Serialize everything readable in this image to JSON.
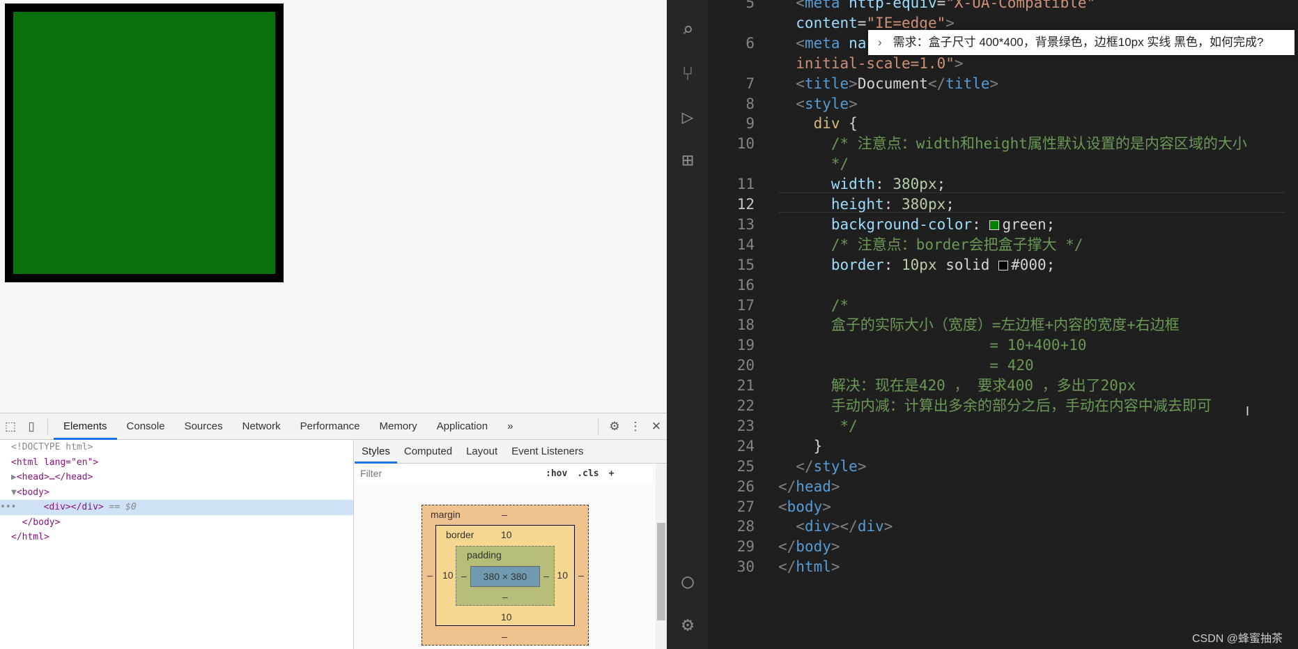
{
  "browser": {
    "box_color": "#0a700a",
    "box_border_color": "#000000"
  },
  "devtools": {
    "tabs": [
      "Elements",
      "Console",
      "Sources",
      "Network",
      "Performance",
      "Memory",
      "Application"
    ],
    "more": "»",
    "dom": [
      {
        "indent": "",
        "text": "<!DOCTYPE html>",
        "kind": "doctype"
      },
      {
        "indent": "",
        "text": "<html lang=\"en\">",
        "kind": "tag"
      },
      {
        "indent": "▶",
        "text": "<head>…</head>",
        "kind": "tag"
      },
      {
        "indent": "▼",
        "text": "<body>",
        "kind": "tag"
      },
      {
        "indent": "    ",
        "text": "<div></div>",
        "suffix": " == $0",
        "kind": "selected"
      },
      {
        "indent": "  ",
        "text": "</body>",
        "kind": "tag"
      },
      {
        "indent": "",
        "text": "</html>",
        "kind": "tag"
      }
    ],
    "styles_tabs": [
      "Styles",
      "Computed",
      "Layout",
      "Event Listeners"
    ],
    "filter_placeholder": "Filter",
    "hov": ":hov",
    "cls": ".cls",
    "plus": "+",
    "box_model": {
      "margin_label": "margin",
      "margin": "–",
      "border_label": "border",
      "border": "10",
      "padding_label": "padding",
      "padding": "–",
      "content": "380 × 380"
    }
  },
  "editor": {
    "current_line": "12",
    "tooltip": "需求：盒子尺寸 400*400，背景绿色，边框10px 实线 黑色，如何完成?",
    "rows": [
      {
        "ln": "5",
        "tokens": [
          [
            "  ",
            "t-txt"
          ],
          [
            "<",
            "t-br"
          ],
          [
            "meta",
            "t-tag"
          ],
          [
            " http-equiv",
            "t-attr"
          ],
          [
            "=",
            "t-txt"
          ],
          [
            "\"X-UA-Compatible\"",
            "t-str"
          ]
        ]
      },
      {
        "ln": "",
        "tokens": [
          [
            "  content",
            "t-attr"
          ],
          [
            "=",
            "t-txt"
          ],
          [
            "\"IE=edge\"",
            "t-str"
          ],
          [
            ">",
            "t-br"
          ]
        ]
      },
      {
        "ln": "6",
        "tokens": [
          [
            "  ",
            "t-txt"
          ],
          [
            "<",
            "t-br"
          ],
          [
            "meta",
            "t-tag"
          ],
          [
            " na",
            "t-attr"
          ]
        ]
      },
      {
        "ln": "",
        "tokens": [
          [
            "  initial-scale=1.0\"",
            "t-str"
          ],
          [
            ">",
            "t-br"
          ]
        ]
      },
      {
        "ln": "7",
        "tokens": [
          [
            "  ",
            "t-txt"
          ],
          [
            "<",
            "t-br"
          ],
          [
            "title",
            "t-tag"
          ],
          [
            ">",
            "t-br"
          ],
          [
            "Document",
            "t-txt"
          ],
          [
            "</",
            "t-br"
          ],
          [
            "title",
            "t-tag"
          ],
          [
            ">",
            "t-br"
          ]
        ]
      },
      {
        "ln": "8",
        "tokens": [
          [
            "  ",
            "t-txt"
          ],
          [
            "<",
            "t-br"
          ],
          [
            "style",
            "t-tag"
          ],
          [
            ">",
            "t-br"
          ]
        ]
      },
      {
        "ln": "9",
        "tokens": [
          [
            "    div",
            "t-sel"
          ],
          [
            " {",
            "t-punc"
          ]
        ]
      },
      {
        "ln": "10",
        "tokens": [
          [
            "      /* 注意点：width和height属性默认设置的是内容区域的大小",
            "t-com"
          ]
        ]
      },
      {
        "ln": "",
        "tokens": [
          [
            "      */",
            "t-com"
          ]
        ]
      },
      {
        "ln": "11",
        "tokens": [
          [
            "      width",
            "t-prop"
          ],
          [
            ": ",
            "t-punc"
          ],
          [
            "380px",
            "t-num"
          ],
          [
            ";",
            "t-punc"
          ]
        ]
      },
      {
        "ln": "12",
        "tokens": [
          [
            "      height",
            "t-prop"
          ],
          [
            ": ",
            "t-punc"
          ],
          [
            "380px",
            "t-num"
          ],
          [
            ";",
            "t-punc"
          ]
        ]
      },
      {
        "ln": "13",
        "tokens": [
          [
            "      background-color",
            "t-prop"
          ],
          [
            ": ",
            "t-punc"
          ],
          [
            "#swatch-green",
            "sw"
          ],
          [
            "green",
            "t-txt"
          ],
          [
            ";",
            "t-punc"
          ]
        ]
      },
      {
        "ln": "14",
        "tokens": [
          [
            "      /* 注意点：border会把盒子撑大 */",
            "t-com"
          ]
        ]
      },
      {
        "ln": "15",
        "tokens": [
          [
            "      border",
            "t-prop"
          ],
          [
            ": ",
            "t-punc"
          ],
          [
            "10px",
            "t-num"
          ],
          [
            " solid ",
            "t-txt"
          ],
          [
            "#swatch-black",
            "sw"
          ],
          [
            "#000",
            "t-txt"
          ],
          [
            ";",
            "t-punc"
          ]
        ]
      },
      {
        "ln": "16",
        "tokens": []
      },
      {
        "ln": "17",
        "tokens": [
          [
            "      /*",
            "t-com"
          ]
        ]
      },
      {
        "ln": "18",
        "tokens": [
          [
            "      盒子的实际大小（宽度）=左边框+内容的宽度+右边框",
            "t-com"
          ]
        ]
      },
      {
        "ln": "19",
        "tokens": [
          [
            "                        = 10+400+10",
            "t-com"
          ]
        ]
      },
      {
        "ln": "20",
        "tokens": [
          [
            "                        = 420",
            "t-com"
          ]
        ]
      },
      {
        "ln": "21",
        "tokens": [
          [
            "      解决：现在是420 ， 要求400 ，多出了20px",
            "t-com"
          ]
        ]
      },
      {
        "ln": "22",
        "tokens": [
          [
            "      手动内减：计算出多余的部分之后，手动在内容中减去即可",
            "t-com"
          ]
        ]
      },
      {
        "ln": "23",
        "tokens": [
          [
            "       */",
            "t-com"
          ]
        ]
      },
      {
        "ln": "24",
        "tokens": [
          [
            "    }",
            "t-punc"
          ]
        ]
      },
      {
        "ln": "25",
        "tokens": [
          [
            "  ",
            "t-txt"
          ],
          [
            "</",
            "t-br"
          ],
          [
            "style",
            "t-tag"
          ],
          [
            ">",
            "t-br"
          ]
        ]
      },
      {
        "ln": "26",
        "tokens": [
          [
            "</",
            "t-br"
          ],
          [
            "head",
            "t-tag"
          ],
          [
            ">",
            "t-br"
          ]
        ]
      },
      {
        "ln": "27",
        "tokens": [
          [
            "<",
            "t-br"
          ],
          [
            "body",
            "t-tag"
          ],
          [
            ">",
            "t-br"
          ]
        ]
      },
      {
        "ln": "28",
        "tokens": [
          [
            "  ",
            "t-txt"
          ],
          [
            "<",
            "t-br"
          ],
          [
            "div",
            "t-tag"
          ],
          [
            "></",
            "t-br"
          ],
          [
            "div",
            "t-tag"
          ],
          [
            ">",
            "t-br"
          ]
        ]
      },
      {
        "ln": "29",
        "tokens": [
          [
            "</",
            "t-br"
          ],
          [
            "body",
            "t-tag"
          ],
          [
            ">",
            "t-br"
          ]
        ]
      },
      {
        "ln": "30",
        "tokens": [
          [
            "</",
            "t-br"
          ],
          [
            "html",
            "t-tag"
          ],
          [
            ">",
            "t-br"
          ]
        ]
      }
    ],
    "swatches": {
      "green": "#008000",
      "black": "#000000"
    }
  },
  "watermark": "CSDN @蜂蜜抽茶"
}
